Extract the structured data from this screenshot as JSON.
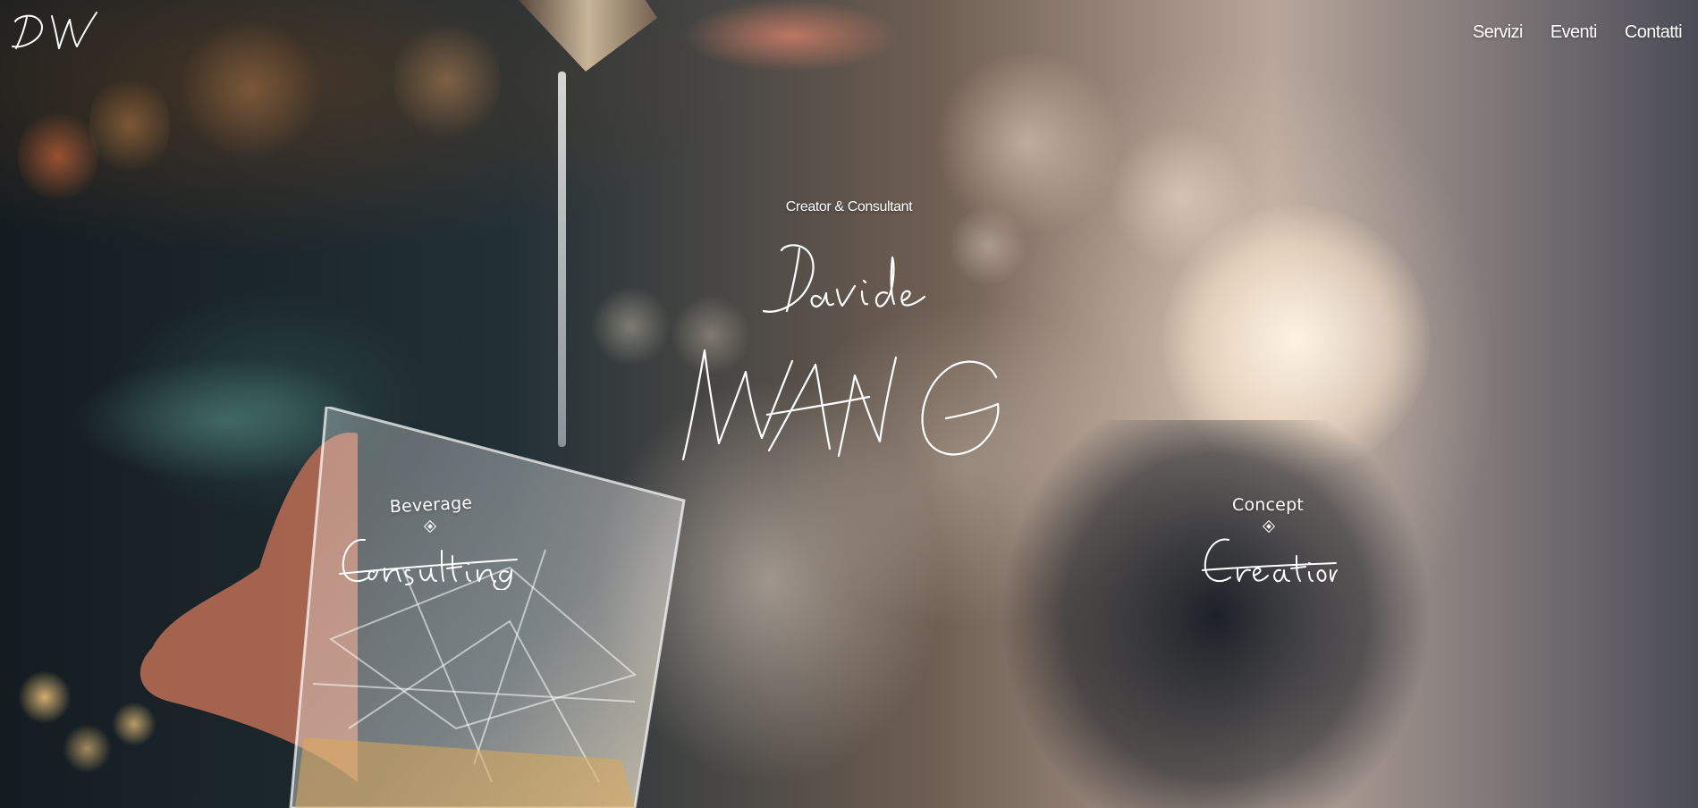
{
  "brand": {
    "logo_text": "DW",
    "logo_icon": "signature-monogram"
  },
  "nav": {
    "items": [
      {
        "label": "Servizi"
      },
      {
        "label": "Eventi"
      },
      {
        "label": "Contatti"
      }
    ]
  },
  "hero": {
    "subtitle": "Creator & Consultant",
    "first_name": "Davide",
    "last_name": "WANG",
    "background_image": "bartender-pouring-into-crystal-glass",
    "left_service": {
      "top_label": "Beverage",
      "script_label": "Consulting",
      "icon": "diamond-icon"
    },
    "right_service": {
      "top_label": "Concept",
      "script_label": "Creation",
      "icon": "diamond-icon"
    }
  },
  "colors": {
    "text": "#ffffff",
    "background_dark": "#0d1418"
  }
}
